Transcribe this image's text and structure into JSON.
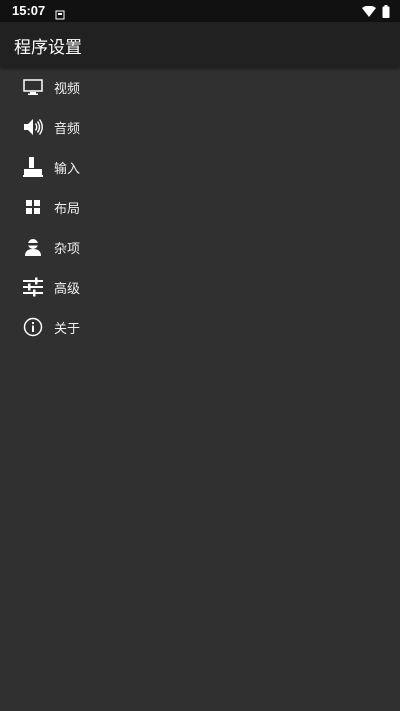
{
  "status_bar": {
    "time": "15:07",
    "icons": [
      "notification-icon",
      "wifi-icon",
      "battery-icon"
    ]
  },
  "app_bar": {
    "title": "程序设置"
  },
  "menu": {
    "items": [
      {
        "label": "视频",
        "icon": "monitor-icon"
      },
      {
        "label": "音频",
        "icon": "speaker-icon"
      },
      {
        "label": "输入",
        "icon": "joystick-icon"
      },
      {
        "label": "布局",
        "icon": "grid-icon"
      },
      {
        "label": "杂项",
        "icon": "person-icon"
      },
      {
        "label": "高级",
        "icon": "sliders-icon"
      },
      {
        "label": "关于",
        "icon": "info-icon"
      }
    ]
  },
  "colors": {
    "background": "#303030",
    "app_bar": "#212121",
    "status_bar": "#111111",
    "text": "#ffffff"
  }
}
